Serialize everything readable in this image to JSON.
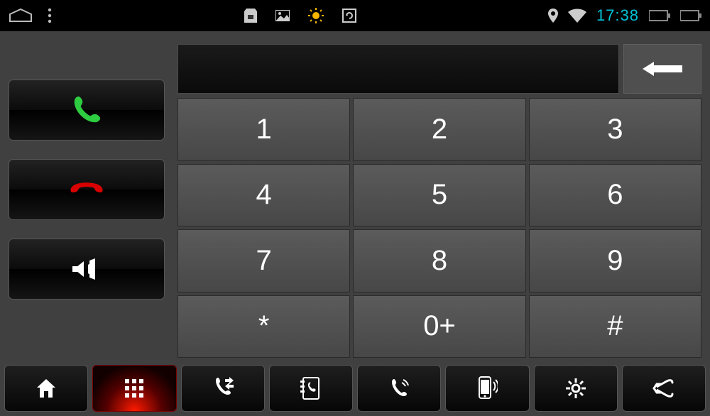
{
  "status_bar": {
    "time": "17:38"
  },
  "dialer": {
    "display_value": "",
    "keys": [
      "1",
      "2",
      "3",
      "4",
      "5",
      "6",
      "7",
      "8",
      "9",
      "*",
      "0+",
      "#"
    ]
  },
  "side_buttons": {
    "call": "call",
    "end": "end-call",
    "mute": "mute"
  },
  "bottom_nav": {
    "items": [
      "home",
      "dialpad",
      "call-log",
      "contacts",
      "recent",
      "sms",
      "settings",
      "back"
    ],
    "active_index": 1
  }
}
